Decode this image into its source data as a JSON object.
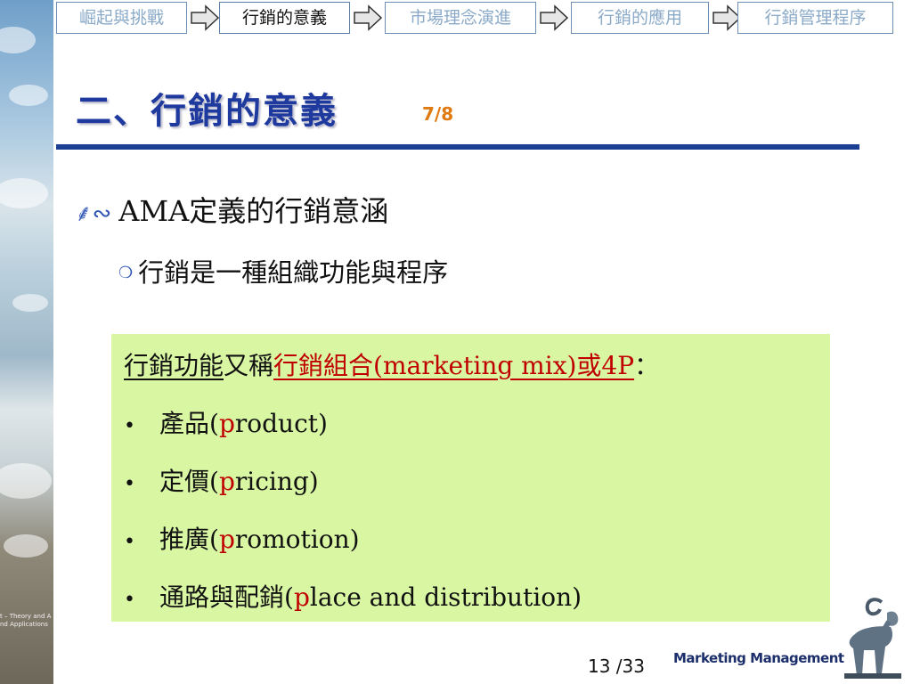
{
  "nav": {
    "tabs": [
      {
        "label": "崛起與挑戰",
        "active": false
      },
      {
        "label": "行銷的意義",
        "active": true
      },
      {
        "label": "市場理念演進",
        "active": false
      },
      {
        "label": "行銷的應用",
        "active": false
      },
      {
        "label": "行銷管理程序",
        "active": false
      }
    ]
  },
  "slide": {
    "title": "二、行銷的意義",
    "page_fraction": "7/8",
    "bullet_1": "AMA定義的行銷意涵",
    "bullet_2": "行銷是一種組織功能與程序"
  },
  "mix_box": {
    "intro_underlined": "行銷功能",
    "intro_mid": "又稱",
    "intro_red": "行銷組合(marketing mix)或4P",
    "intro_colon": "：",
    "items": [
      {
        "prefix": "產品(",
        "red_letter": "p",
        "rest": "roduct)"
      },
      {
        "prefix": "定價(",
        "red_letter": "p",
        "rest": "ricing)"
      },
      {
        "prefix": "推廣(",
        "red_letter": "p",
        "rest": "romotion)"
      },
      {
        "prefix": "通路與配銷(",
        "red_letter": "p",
        "rest": "lace and distribution)"
      }
    ]
  },
  "footer": {
    "page_number": "13 /33",
    "brand": "Marketing Management"
  },
  "side_caption": {
    "line1": "t – Theory and A",
    "line2": "nd Applications"
  },
  "colors": {
    "title": "#1f3a9e",
    "rule": "#1a3f93",
    "page_fraction": "#e07a10",
    "box_background": "#d9f7a3",
    "red": "#c00000"
  },
  "icons": {
    "bullet_1": "scroll-bullet-icon",
    "bullet_2": "hollow-circle-bullet-icon",
    "nav_arrow": "right-arrow-icon",
    "logo": "goat-logo-icon"
  }
}
